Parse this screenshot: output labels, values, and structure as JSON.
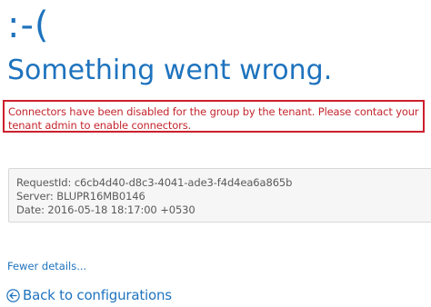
{
  "error_page": {
    "emoticon": ":-(",
    "headline": "Something went wrong.",
    "message_line1": "Connectors have been disabled for the group by the tenant. Please contact your",
    "message_line2": "tenant admin to enable connectors."
  },
  "details": {
    "request_id": "RequestId: c6cb4d40-d8c3-4041-ade3-f4d4ea6a865b",
    "server": "Server: BLUPR16MB0146",
    "date": "Date: 2016-05-18 18:17:00 +0530"
  },
  "links": {
    "fewer_details": "Fewer details...",
    "back_to_configurations": "Back to configurations",
    "back_icon": "back-arrow-circle-icon"
  },
  "colors": {
    "accent": "#1e73be",
    "error": "#cc1f2d",
    "details_bg": "#f6f6f6"
  }
}
